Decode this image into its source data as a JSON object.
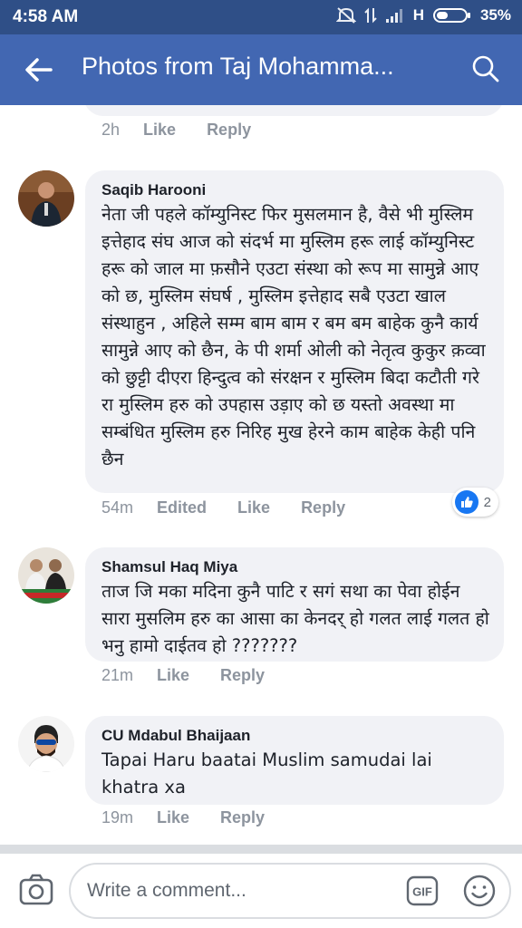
{
  "status_bar": {
    "time": "4:58 AM",
    "network": "H",
    "battery": "35%"
  },
  "app_bar": {
    "title": "Photos from Taj Mohamma..."
  },
  "previous_comment": {
    "age": "2h",
    "like": "Like",
    "reply": "Reply"
  },
  "comments": [
    {
      "author": "Saqib Harooni",
      "text": "नेता जी पहले कॉम्युनिस्ट फिर मुसलमान है, वैसे भी मुस्लिम इत्तेहाद संघ आज को संदर्भ मा मुस्लिम हरू लाई कॉम्युनिस्ट हरू को जाल मा फ़सौने एउटा संस्था को रूप मा सामुन्ने आए को छ, मुस्लिम संघर्ष , मुस्लिम इत्तेहाद सबै एउटा खाल संस्थाहुन ,  अहिले सम्म बाम बाम र बम बम बाहेक कुनै कार्य सामुन्ने आए को छैन, के पी शर्मा ओली को नेतृत्व कुकुर क़व्वा को छुट्टी दीएरा हिन्दुत्व को संरक्षन र मुस्लिम बिदा कटौती गरे रा मुस्लिम हरु को उपहास उड़ाए को छ यस्तो अवस्था मा सम्बंधित मुस्लिम हरु निरिह मुख हेरने काम बाहेक केही पनि छैन",
      "age": "54m",
      "edited": "Edited",
      "like": "Like",
      "reply": "Reply",
      "reaction_count": "2"
    },
    {
      "author": "Shamsul Haq Miya",
      "text": "ताज जि मका मदिना कुनै पाटि र सगं सथा का पेवा होईन सारा मुसलिम हरु   का आसा का केनदर् हो गलत लाई गलत हो भनु हामो दाईतव हो ???????",
      "age": "21m",
      "like": "Like",
      "reply": "Reply"
    },
    {
      "author": "CU Mdabul Bhaijaan",
      "text": "Tapai Haru baatai Muslim samudai lai khatra xa",
      "age": "19m",
      "like": "Like",
      "reply": "Reply"
    }
  ],
  "composer": {
    "placeholder": "Write a comment...",
    "gif_label": "GIF"
  },
  "colors": {
    "status_bar": "#2f4f87",
    "app_bar": "#4267b2",
    "bubble": "#f1f2f6",
    "meta_text": "#8d949e",
    "like_blue": "#1877f2"
  }
}
